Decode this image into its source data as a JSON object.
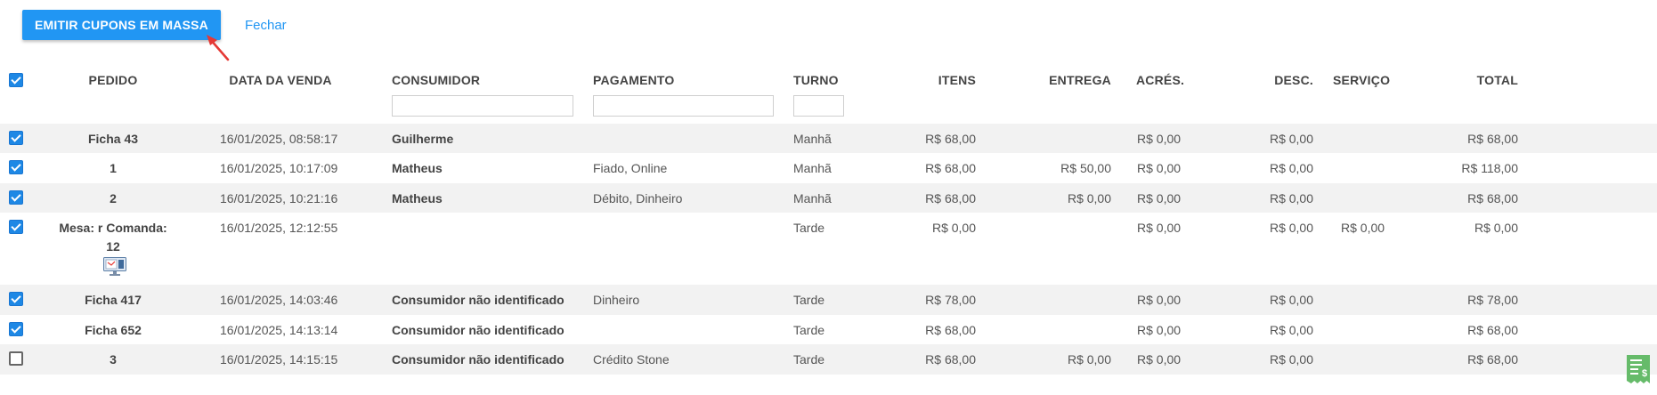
{
  "toolbar": {
    "emit_button": "EMITIR CUPONS EM MASSA",
    "close_link": "Fechar"
  },
  "columns": {
    "pedido": "PEDIDO",
    "data": "DATA DA VENDA",
    "consumidor": "CONSUMIDOR",
    "pagamento": "PAGAMENTO",
    "turno": "TURNO",
    "itens": "ITENS",
    "entrega": "ENTREGA",
    "acres": "ACRÉS.",
    "desc": "DESC.",
    "servico": "SERVIÇO",
    "total": "TOTAL"
  },
  "filters": {
    "consumidor": "",
    "pagamento": "",
    "turno": ""
  },
  "header_checkbox_checked": true,
  "rows": [
    {
      "checked": true,
      "pedido": "Ficha 43",
      "data": "16/01/2025, 08:58:17",
      "consumidor": "Guilherme",
      "pagamento": "",
      "turno": "Manhã",
      "itens": "R$ 68,00",
      "entrega": "",
      "acres": "R$ 0,00",
      "desc": "R$ 0,00",
      "servico": "",
      "total": "R$ 68,00"
    },
    {
      "checked": true,
      "pedido": "1",
      "data": "16/01/2025, 10:17:09",
      "consumidor": "Matheus",
      "pagamento": "Fiado, Online",
      "turno": "Manhã",
      "itens": "R$ 68,00",
      "entrega": "R$ 50,00",
      "acres": "R$ 0,00",
      "desc": "R$ 0,00",
      "servico": "",
      "total": "R$ 118,00"
    },
    {
      "checked": true,
      "pedido": "2",
      "data": "16/01/2025, 10:21:16",
      "consumidor": "Matheus",
      "pagamento": "Débito, Dinheiro",
      "turno": "Manhã",
      "itens": "R$ 68,00",
      "entrega": "R$ 0,00",
      "acres": "R$ 0,00",
      "desc": "R$ 0,00",
      "servico": "",
      "total": "R$ 68,00"
    },
    {
      "checked": true,
      "pedido_line1": "Mesa: r Comanda:",
      "pedido_line2": "12",
      "data": "16/01/2025, 12:12:55",
      "consumidor": "",
      "pagamento": "",
      "turno": "Tarde",
      "itens": "R$ 0,00",
      "entrega": "",
      "acres": "R$ 0,00",
      "desc": "R$ 0,00",
      "servico": "R$ 0,00",
      "total": "R$ 0,00",
      "icon": "monitor-icon"
    },
    {
      "checked": true,
      "pedido": "Ficha 417",
      "data": "16/01/2025, 14:03:46",
      "consumidor": "Consumidor não identificado",
      "pagamento": "Dinheiro",
      "turno": "Tarde",
      "itens": "R$ 78,00",
      "entrega": "",
      "acres": "R$ 0,00",
      "desc": "R$ 0,00",
      "servico": "",
      "total": "R$ 78,00"
    },
    {
      "checked": true,
      "pedido": "Ficha 652",
      "data": "16/01/2025, 14:13:14",
      "consumidor": "Consumidor não identificado",
      "pagamento": "",
      "turno": "Tarde",
      "itens": "R$ 68,00",
      "entrega": "",
      "acres": "R$ 0,00",
      "desc": "R$ 0,00",
      "servico": "",
      "total": "R$ 68,00"
    },
    {
      "checked": false,
      "pedido": "3",
      "data": "16/01/2025, 14:15:15",
      "consumidor": "Consumidor não identificado",
      "pagamento": "Crédito Stone",
      "turno": "Tarde",
      "itens": "R$ 68,00",
      "entrega": "R$ 0,00",
      "acres": "R$ 0,00",
      "desc": "R$ 0,00",
      "servico": "",
      "total": "R$ 68,00"
    }
  ],
  "icons": {
    "arrow": "red-arrow-icon",
    "order_source": "monitor-icon",
    "receipt": "receipt-icon"
  },
  "colors": {
    "primary": "#2196f3",
    "checkbox": "#1e88e5",
    "arrow": "#e53935",
    "receipt": "#66bb6a",
    "row_alt": "#f2f2f2"
  }
}
